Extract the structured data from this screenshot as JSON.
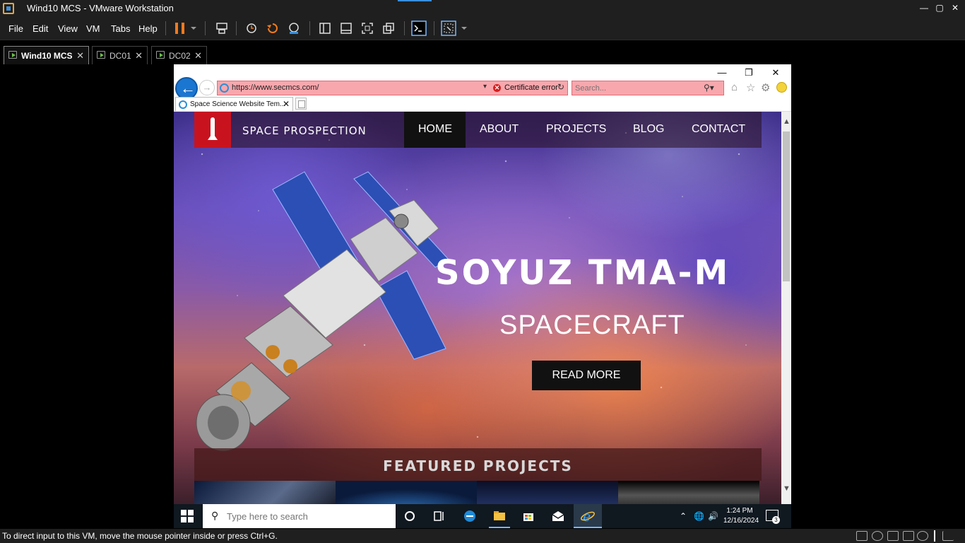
{
  "vmware": {
    "title": "Wind10 MCS - VMware Workstation",
    "menu": [
      "File",
      "Edit",
      "View",
      "VM",
      "Tabs",
      "Help"
    ],
    "tabs": [
      {
        "label": "Wind10 MCS",
        "active": true
      },
      {
        "label": "DC01",
        "active": false
      },
      {
        "label": "DC02",
        "active": false
      }
    ],
    "status_message": "To direct input to this VM, move the mouse pointer inside or press Ctrl+G."
  },
  "browser": {
    "url": "https://www.secmcs.com/",
    "certificate_label": "Certificate error",
    "search_placeholder": "Search...",
    "tab_title": "Space Science Website Tem...",
    "colors": {
      "address_error_bg": "#f8a7ad",
      "back_button": "#1b76d1"
    }
  },
  "site": {
    "brand": "SPACE PROSPECTION",
    "nav": [
      {
        "label": "HOME",
        "active": true
      },
      {
        "label": "ABOUT",
        "active": false
      },
      {
        "label": "PROJECTS",
        "active": false
      },
      {
        "label": "BLOG",
        "active": false
      },
      {
        "label": "CONTACT",
        "active": false
      }
    ],
    "hero_title": "SOYUZ TMA-M",
    "hero_subtitle": "SPACECRAFT",
    "read_more": "READ MORE",
    "featured_title": "FEATURED PROJECTS",
    "colors": {
      "logo_bg": "#c8131f",
      "nav_active_bg": "#111111"
    }
  },
  "taskbar": {
    "search_placeholder": "Type here to search",
    "time": "1:24 PM",
    "date": "12/16/2024",
    "notification_count": "3"
  }
}
